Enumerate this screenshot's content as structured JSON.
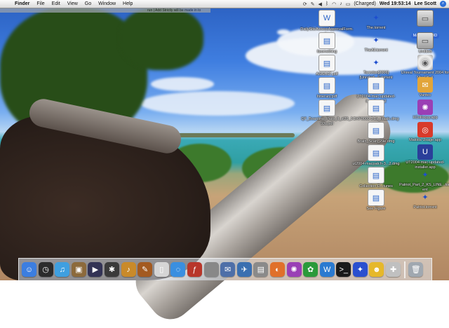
{
  "menubar": {
    "apple": "",
    "app_name": "Finder",
    "items": [
      "File",
      "Edit",
      "View",
      "Go",
      "Window",
      "Help"
    ],
    "status": {
      "battery": "(Charged)",
      "clock": "Wed 19:53:14",
      "user": "Lee Scott"
    }
  },
  "window_strip": {
    "title": "run | Add Strictly will be made in to"
  },
  "desktop_icons": [
    {
      "label": "DailySiteAccessApprovalForm.doc",
      "kind": "doc",
      "glyph": "W"
    },
    {
      "label": "The.torrent",
      "kind": "torrent",
      "glyph": "✦"
    },
    {
      "label": "Macintosh HD",
      "kind": "drive",
      "glyph": "▭",
      "selected": true
    },
    {
      "label": "Itsomething",
      "kind": "doc",
      "glyph": "▤"
    },
    {
      "label": "TheAll.torrent",
      "kind": "torrent",
      "glyph": "✦"
    },
    {
      "label": "Untitled",
      "kind": "drive",
      "glyph": "▭"
    },
    {
      "label": "ASWA07.pdf",
      "kind": "doc",
      "glyph": "▤"
    },
    {
      "label": "Tarzotas[2006][Unrated...E.torrent",
      "kind": "torrent",
      "glyph": "✦"
    },
    {
      "label": "Unreal Tournament 2004 for MacOS X",
      "kind": "disc",
      "glyph": "◉"
    },
    {
      "label": "Itinerary.pdf",
      "kind": "doc",
      "glyph": "▤"
    },
    {
      "label": "UT2004-mac-updated-installer.bz2",
      "kind": "doc",
      "glyph": "▤"
    },
    {
      "label": "Vantec",
      "kind": "app",
      "glyph": "✉",
      "color": "#e2a53a"
    },
    {
      "label": "QF_Boarding_Pass_II_sl29_29Ju.pdf",
      "kind": "doc",
      "glyph": "▤"
    },
    {
      "label": "DXF0009 3.1a_lsaalc.dmg",
      "kind": "doc",
      "glyph": "▤"
    },
    {
      "label": "XColloquy.app",
      "kind": "app",
      "glyph": "✺",
      "color": "#9a3fb5"
    },
    {
      "label": "Brain_Scan_29e.dmg",
      "kind": "doc",
      "glyph": "▤"
    },
    {
      "label": "Matilda Usage.app",
      "kind": "app",
      "glyph": "◎",
      "color": "#d83a2a"
    },
    {
      "label": "ut2004-macpatch-3...2.dmg",
      "kind": "doc",
      "glyph": "▤"
    },
    {
      "label": "UT2004-mac-updated-installer.app",
      "kind": "app",
      "glyph": "U",
      "color": "#2a3f9a"
    },
    {
      "label": "Collection D...tunes",
      "kind": "doc",
      "glyph": "▤"
    },
    {
      "label": "Patriot_Part_2_KS_LINE...torrent",
      "kind": "torrent",
      "glyph": "✦"
    },
    {
      "label": "See Figure",
      "kind": "doc",
      "glyph": "▤"
    },
    {
      "label": "Patriot.torrent",
      "kind": "torrent",
      "glyph": "✦"
    }
  ],
  "dock": {
    "items": [
      {
        "name": "finder",
        "glyph": "☺",
        "color": "#3c7ee0"
      },
      {
        "name": "dashboard",
        "glyph": "◷",
        "color": "#2b2b2b"
      },
      {
        "name": "itunes",
        "glyph": "♫",
        "color": "#3f9fe0"
      },
      {
        "name": "iphoto",
        "glyph": "▣",
        "color": "#8c6a3c"
      },
      {
        "name": "imovie",
        "glyph": "▶",
        "color": "#333355"
      },
      {
        "name": "idvd",
        "glyph": "✱",
        "color": "#3a3a3a"
      },
      {
        "name": "garageband",
        "glyph": "♪",
        "color": "#c98a2a"
      },
      {
        "name": "guitar",
        "glyph": "✎",
        "color": "#a35a20"
      },
      {
        "name": "ipod",
        "glyph": "▯",
        "color": "#d5d5d5"
      },
      {
        "name": "safari",
        "glyph": "◌",
        "color": "#3a8fe0"
      },
      {
        "name": "flash",
        "glyph": "ƒ",
        "color": "#b8362a"
      },
      {
        "name": "system-preferences",
        "glyph": "",
        "color": "#888888"
      },
      {
        "name": "mail",
        "glyph": "✉",
        "color": "#4e6fa8"
      },
      {
        "name": "bird",
        "glyph": "✈",
        "color": "#3a6fb0"
      },
      {
        "name": "address-book",
        "glyph": "▤",
        "color": "#8a8a8a"
      },
      {
        "name": "firefox",
        "glyph": "◐",
        "color": "#e0702a"
      },
      {
        "name": "colloquy",
        "glyph": "✺",
        "color": "#9a3fb5"
      },
      {
        "name": "frog",
        "glyph": "✿",
        "color": "#2a9a3a"
      },
      {
        "name": "worldtime",
        "glyph": "W",
        "color": "#2a7ad0"
      },
      {
        "name": "terminal",
        "glyph": ">_",
        "color": "#1a1a1a"
      },
      {
        "name": "transmission",
        "glyph": "✦",
        "color": "#2a4fcf"
      },
      {
        "name": "adium",
        "glyph": "☻",
        "color": "#e6b82a"
      },
      {
        "name": "preview",
        "glyph": "✚",
        "color": "#c0c0c0"
      }
    ],
    "right_items": [
      {
        "name": "trash",
        "glyph": "🗑",
        "color": "#a0a8b0"
      }
    ]
  }
}
